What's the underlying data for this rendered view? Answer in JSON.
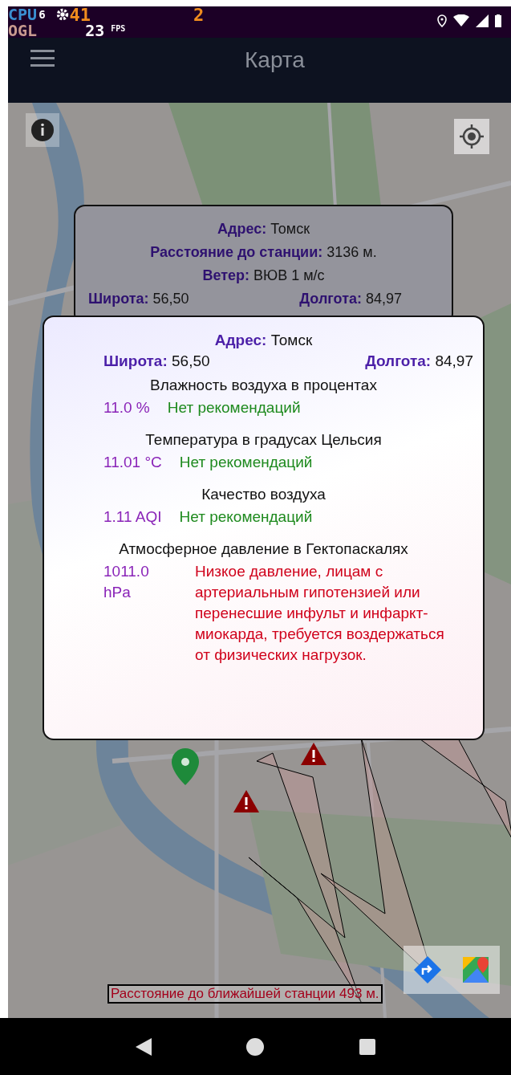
{
  "status_bar": {
    "cpu_label": "CPU",
    "cpu_value": "6",
    "temperature": "41",
    "load": "2",
    "gl_label": "OGL",
    "fps_value": "23",
    "fps_label": "FPS"
  },
  "app_bar": {
    "title": "Карта"
  },
  "map": {
    "kind": "picture",
    "info_window": {
      "rows": [
        {
          "label": "Адрес:",
          "value": "Томск"
        },
        {
          "label": "Расстояние до станции:",
          "value": "3136 м."
        },
        {
          "label": "Ветер:",
          "value": "ВЮВ 1 м/с"
        }
      ],
      "latitude": {
        "label": "Широта:",
        "value": "56,50"
      },
      "longitude": {
        "label": "Долгота:",
        "value": "84,97"
      }
    },
    "distance_label": "Расстояние до ближайшей станции 493 м."
  },
  "dialog": {
    "address": {
      "label": "Адрес:",
      "value": "Томск"
    },
    "latitude": {
      "label": "Широта:",
      "value": "56,50"
    },
    "longitude": {
      "label": "Долгота:",
      "value": "84,97"
    },
    "sections": [
      {
        "title": "Влажность воздуха в процентах",
        "value": "11.0 %",
        "recommendation": "Нет рекомендаций",
        "color": "#1e8a1e"
      },
      {
        "title": "Температура в градусах Цельсия",
        "value": "11.01 °C",
        "recommendation": "Нет рекомендаций",
        "color": "#1e8a1e"
      },
      {
        "title": "Качество воздуха",
        "value": "1.11 AQI",
        "recommendation": "Нет рекомендаций",
        "color": "#1e8a1e"
      },
      {
        "title": "Атмосферное давление в Гектопаскалях",
        "value": "1011.0 hPa",
        "recommendation": "Низкое давление, лицам с артериальным гипотензией или перенесшие инфульт и инфаркт-миокарда, требуется воздержаться от физических нагрузок.",
        "color": "#d0021b"
      }
    ]
  }
}
